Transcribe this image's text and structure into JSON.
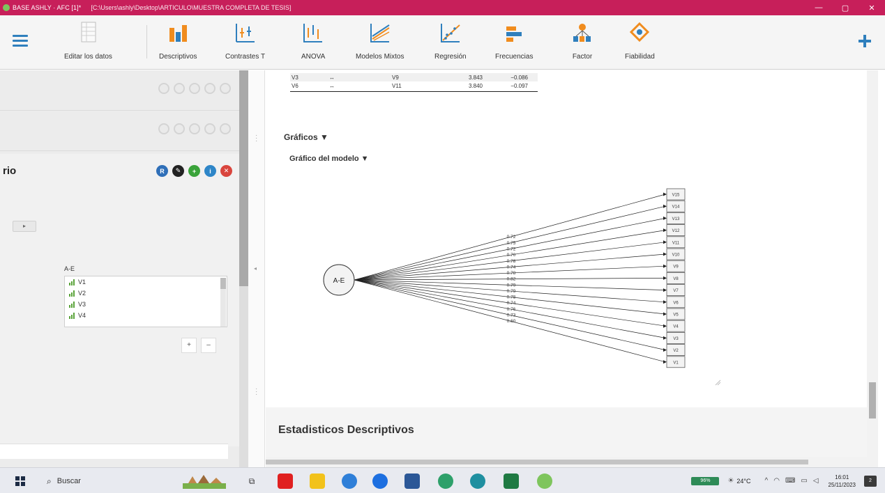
{
  "window": {
    "title": "BASE ASHLY · AFC [1]*",
    "path": "[C:\\Users\\ashly\\Desktop\\ARTICULO\\MUESTRA COMPLETA DE TESIS]",
    "controls": [
      "—",
      "▢",
      "✕"
    ]
  },
  "ribbon": {
    "buttons": [
      {
        "label": "Editar los datos",
        "icon": "spreadsheet-icon"
      },
      {
        "label": "Descriptivos",
        "icon": "bar-chart-icon"
      },
      {
        "label": "Contrastes T",
        "icon": "t-test-icon"
      },
      {
        "label": "ANOVA",
        "icon": "anova-icon"
      },
      {
        "label": "Modelos Mixtos",
        "icon": "mixed-models-icon"
      },
      {
        "label": "Regresión",
        "icon": "regression-icon"
      },
      {
        "label": "Frecuencias",
        "icon": "frequencies-icon"
      },
      {
        "label": "Factor",
        "icon": "factor-icon"
      },
      {
        "label": "Fiabilidad",
        "icon": "reliability-icon"
      }
    ]
  },
  "left_panel": {
    "analysis_title": "rio",
    "factor_label": "A-E",
    "variables": [
      "V1",
      "V2",
      "V3",
      "V4"
    ],
    "move_arrow": "▸",
    "small_buttons": [
      "+",
      "–"
    ]
  },
  "results_table": {
    "rows": [
      {
        "lhs": "V3",
        "op": "↔",
        "rhs": "V9",
        "mi": "3.843",
        "epc": "−0.086"
      },
      {
        "lhs": "V6",
        "op": "↔",
        "rhs": "V11",
        "mi": "3.840",
        "epc": "−0.097"
      }
    ]
  },
  "sections": {
    "graficos": "Gráficos ▼",
    "grafico_modelo": "Gráfico del modelo ▼",
    "descriptivos": "Estadisticos Descriptivos"
  },
  "model": {
    "factor": "A-E",
    "indicators": [
      "V15",
      "V14",
      "V13",
      "V12",
      "V11",
      "V10",
      "V9",
      "V8",
      "V7",
      "V6",
      "V5",
      "V4",
      "V3",
      "V2",
      "V1"
    ],
    "loadings": [
      "0.72",
      "0.75",
      "0.72",
      "0.70",
      "0.78",
      "0.74",
      "0.78",
      "0.82",
      "0.79",
      "0.79",
      "0.78",
      "0.74",
      "0.76",
      "0.73",
      "0.60"
    ]
  },
  "taskbar": {
    "search_placeholder": "Buscar",
    "battery": "96%",
    "temperature": "24°C",
    "time": "16:01",
    "date": "25/11/2023",
    "notifications": "2"
  }
}
